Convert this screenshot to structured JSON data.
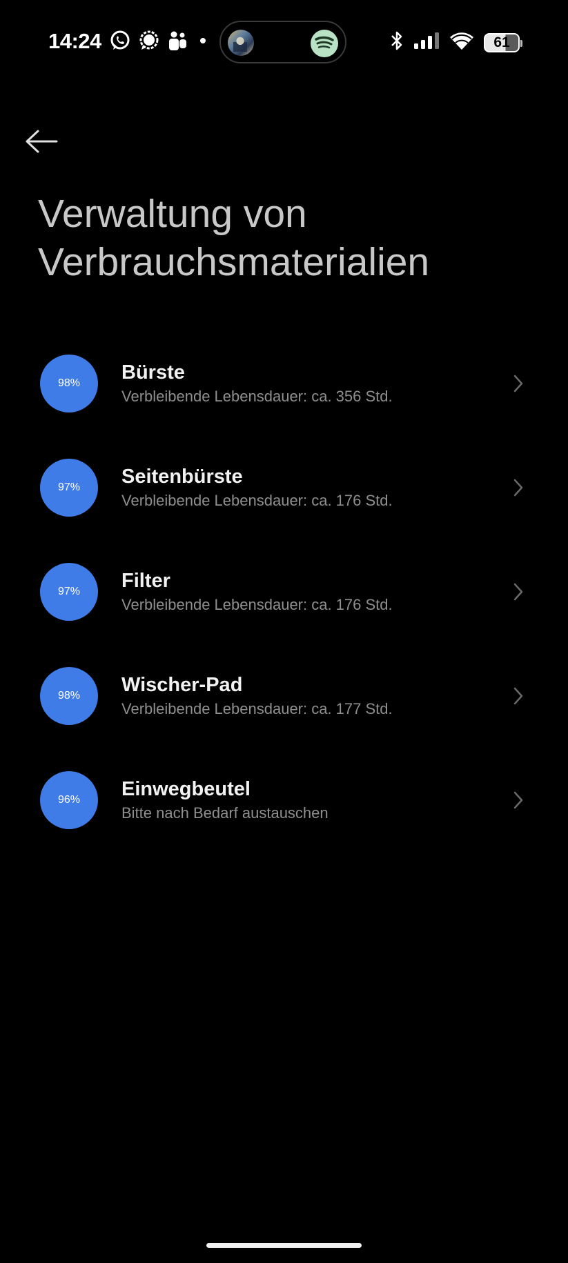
{
  "status_bar": {
    "time": "14:24",
    "battery_level": "61",
    "left_icons": [
      "whatsapp-icon",
      "signal-messenger-icon",
      "teams-icon"
    ],
    "right_icons": [
      "bluetooth-icon",
      "cellular-signal-icon",
      "wifi-icon",
      "battery-icon"
    ],
    "island_icons": [
      "album-art",
      "spotify-icon"
    ]
  },
  "header": {
    "back_icon": "arrow-left-icon",
    "title": "Verwaltung von Verbrauchsmaterialien"
  },
  "colors": {
    "accent": "#3f7ce8",
    "background": "#000000",
    "title": "#c8c8c8",
    "subtitle": "#8f8f8f"
  },
  "items": [
    {
      "percent_label": "98%",
      "percent": 98,
      "name": "Bürste",
      "subtitle": "Verbleibende Lebensdauer: ca. 356 Std."
    },
    {
      "percent_label": "97%",
      "percent": 97,
      "name": "Seitenbürste",
      "subtitle": "Verbleibende Lebensdauer: ca. 176 Std."
    },
    {
      "percent_label": "97%",
      "percent": 97,
      "name": "Filter",
      "subtitle": "Verbleibende Lebensdauer: ca. 176 Std."
    },
    {
      "percent_label": "98%",
      "percent": 98,
      "name": "Wischer-Pad",
      "subtitle": "Verbleibende Lebensdauer: ca. 177 Std."
    },
    {
      "percent_label": "96%",
      "percent": 96,
      "name": "Einwegbeutel",
      "subtitle": "Bitte nach Bedarf austauschen"
    }
  ]
}
